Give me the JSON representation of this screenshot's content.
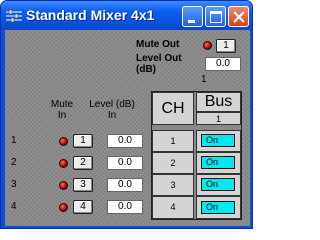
{
  "window": {
    "title": "Standard Mixer 4x1"
  },
  "master": {
    "mute_out_label": "Mute Out",
    "mute_out_value": "1",
    "level_out_label_line1": "Level Out",
    "level_out_label_line2": "(dB)",
    "level_out_value": "0.0",
    "index": "1"
  },
  "headers": {
    "mute_in_line1": "Mute",
    "mute_in_line2": "In",
    "level_in_line1": "Level (dB)",
    "level_in_line2": "In",
    "ch": "CH",
    "bus": "Bus",
    "bus_number": "1"
  },
  "inputs": [
    {
      "index": "1",
      "mute": "1",
      "level": "0.0",
      "ch": "1",
      "bus_state": "On"
    },
    {
      "index": "2",
      "mute": "2",
      "level": "0.0",
      "ch": "2",
      "bus_state": "On"
    },
    {
      "index": "3",
      "mute": "3",
      "level": "0.0",
      "ch": "3",
      "bus_state": "On"
    },
    {
      "index": "4",
      "mute": "4",
      "level": "0.0",
      "ch": "4",
      "bus_state": "On"
    }
  ],
  "colors": {
    "led": "#c00000",
    "on_button": "#00e8f0",
    "titlebar": "#0a52e0"
  },
  "icons": {
    "app": "mixer-app-icon",
    "minimize": "minimize-icon",
    "maximize": "maximize-icon",
    "close": "close-icon"
  }
}
